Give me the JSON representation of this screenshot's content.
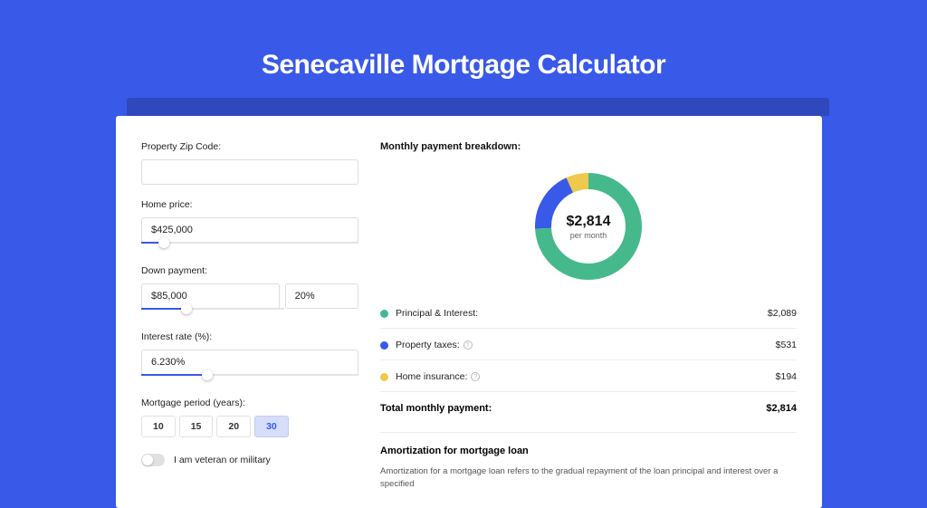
{
  "title": "Senecaville Mortgage Calculator",
  "left": {
    "zip_label": "Property Zip Code:",
    "zip_value": "",
    "home_price_label": "Home price:",
    "home_price_value": "$425,000",
    "down_payment_label": "Down payment:",
    "down_payment_value": "$85,000",
    "down_payment_pct": "20%",
    "interest_label": "Interest rate (%):",
    "interest_value": "6.230%",
    "period_label": "Mortgage period (years):",
    "periods": [
      "10",
      "15",
      "20",
      "30"
    ],
    "period_active": "30",
    "veteran_label": "I am veteran or military"
  },
  "right": {
    "breakdown_title": "Monthly payment breakdown:",
    "center_amount": "$2,814",
    "center_sub": "per month",
    "legend": [
      {
        "label": "Principal & Interest:",
        "value": "$2,089",
        "color": "green",
        "help": false
      },
      {
        "label": "Property taxes:",
        "value": "$531",
        "color": "blue",
        "help": true
      },
      {
        "label": "Home insurance:",
        "value": "$194",
        "color": "yellow",
        "help": true
      }
    ],
    "total_label": "Total monthly payment:",
    "total_value": "$2,814",
    "amort_title": "Amortization for mortgage loan",
    "amort_text": "Amortization for a mortgage loan refers to the gradual repayment of the loan principal and interest over a specified"
  },
  "chart_data": {
    "type": "pie",
    "title": "Monthly payment breakdown",
    "series": [
      {
        "name": "Principal & Interest",
        "value": 2089,
        "color": "#46b98c"
      },
      {
        "name": "Property taxes",
        "value": 531,
        "color": "#3959e8"
      },
      {
        "name": "Home insurance",
        "value": 194,
        "color": "#efc94c"
      }
    ],
    "total": 2814,
    "center_label": "$2,814 per month"
  },
  "colors": {
    "green": "#46b98c",
    "blue": "#3959e8",
    "yellow": "#efc94c"
  }
}
